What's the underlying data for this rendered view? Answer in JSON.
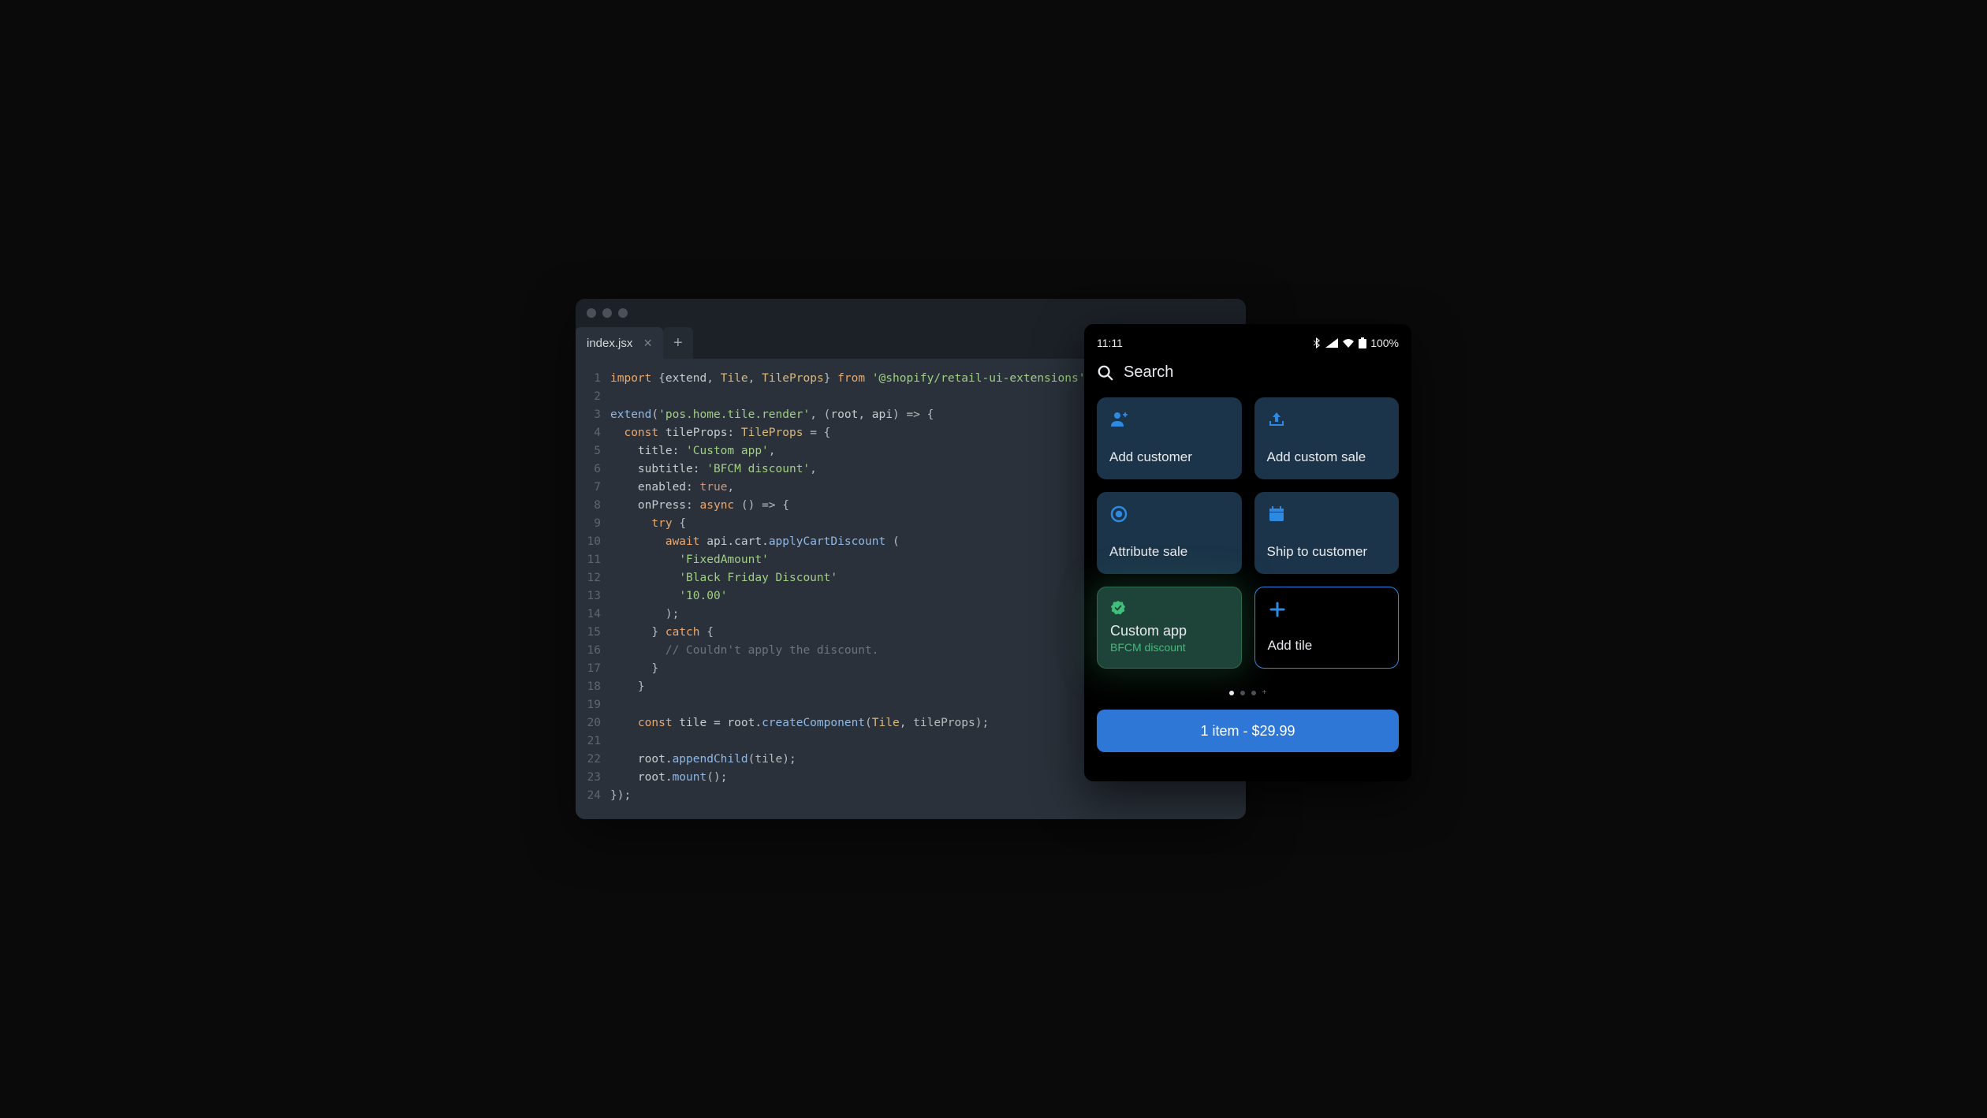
{
  "editor": {
    "tab_label": "index.jsx",
    "line_numbers": [
      "1",
      "2",
      "3",
      "4",
      "5",
      "6",
      "7",
      "8",
      "9",
      "10",
      "11",
      "12",
      "13",
      "14",
      "15",
      "16",
      "17",
      "18",
      "19",
      "20",
      "21",
      "22",
      "23",
      "24"
    ],
    "code": [
      [
        [
          "kw",
          "import"
        ],
        [
          "pun",
          " {"
        ],
        [
          "",
          "extend"
        ],
        [
          "pun",
          ", "
        ],
        [
          "cls",
          "Tile"
        ],
        [
          "pun",
          ", "
        ],
        [
          "cls",
          "TileProps"
        ],
        [
          "pun",
          "} "
        ],
        [
          "kw",
          "from"
        ],
        [
          "",
          " "
        ],
        [
          "str",
          "'@shopify/retail-ui-extensions'"
        ],
        [
          "pun",
          ";"
        ]
      ],
      [],
      [
        [
          "fn",
          "extend"
        ],
        [
          "pun",
          "("
        ],
        [
          "str",
          "'pos.home.tile.render'"
        ],
        [
          "pun",
          ", ("
        ],
        [
          "",
          "root"
        ],
        [
          "pun",
          ", "
        ],
        [
          "",
          "api"
        ],
        [
          "pun",
          ") => {"
        ]
      ],
      [
        [
          "",
          "  "
        ],
        [
          "kw",
          "const"
        ],
        [
          "",
          " tileProps: "
        ],
        [
          "cls",
          "TileProps"
        ],
        [
          "pun",
          " = {"
        ]
      ],
      [
        [
          "",
          "    title: "
        ],
        [
          "str",
          "'Custom app'"
        ],
        [
          "pun",
          ","
        ]
      ],
      [
        [
          "",
          "    subtitle: "
        ],
        [
          "str",
          "'BFCM discount'"
        ],
        [
          "pun",
          ","
        ]
      ],
      [
        [
          "",
          "    enabled: "
        ],
        [
          "lit",
          "true"
        ],
        [
          "pun",
          ","
        ]
      ],
      [
        [
          "",
          "    onPress: "
        ],
        [
          "kw",
          "async"
        ],
        [
          "pun",
          " () => {"
        ]
      ],
      [
        [
          "",
          "      "
        ],
        [
          "kw",
          "try"
        ],
        [
          "pun",
          " {"
        ]
      ],
      [
        [
          "",
          "        "
        ],
        [
          "kw",
          "await"
        ],
        [
          "",
          " api.cart."
        ],
        [
          "fn",
          "applyCartDiscount"
        ],
        [
          "pun",
          " ("
        ]
      ],
      [
        [
          "",
          "          "
        ],
        [
          "str",
          "'FixedAmount'"
        ]
      ],
      [
        [
          "",
          "          "
        ],
        [
          "str",
          "'Black Friday Discount'"
        ]
      ],
      [
        [
          "",
          "          "
        ],
        [
          "str",
          "'10.00'"
        ]
      ],
      [
        [
          "",
          "        "
        ],
        [
          "pun",
          ");"
        ]
      ],
      [
        [
          "",
          "      "
        ],
        [
          "pun",
          "} "
        ],
        [
          "kw",
          "catch"
        ],
        [
          "pun",
          " {"
        ]
      ],
      [
        [
          "",
          "        "
        ],
        [
          "com",
          "// Couldn't apply the discount."
        ]
      ],
      [
        [
          "",
          "      "
        ],
        [
          "pun",
          "}"
        ]
      ],
      [
        [
          "",
          "    "
        ],
        [
          "pun",
          "}"
        ]
      ],
      [],
      [
        [
          "",
          "    "
        ],
        [
          "kw",
          "const"
        ],
        [
          "",
          " tile = root."
        ],
        [
          "fn",
          "createComponent"
        ],
        [
          "pun",
          "("
        ],
        [
          "cls",
          "Tile"
        ],
        [
          "pun",
          ", tileProps);"
        ]
      ],
      [],
      [
        [
          "",
          "    root."
        ],
        [
          "fn",
          "appendChild"
        ],
        [
          "pun",
          "(tile);"
        ]
      ],
      [
        [
          "",
          "    root."
        ],
        [
          "fn",
          "mount"
        ],
        [
          "pun",
          "();"
        ]
      ],
      [
        [
          "pun",
          "});"
        ]
      ]
    ]
  },
  "phone": {
    "status_time": "11:11",
    "battery": "100%",
    "search_label": "Search",
    "tiles": [
      {
        "title": "Add customer",
        "icon": "person"
      },
      {
        "title": "Add custom sale",
        "icon": "upload"
      },
      {
        "title": "Attribute sale",
        "icon": "target"
      },
      {
        "title": "Ship to customer",
        "icon": "calendar"
      }
    ],
    "custom_tile": {
      "title": "Custom app",
      "subtitle": "BFCM discount"
    },
    "add_tile": {
      "title": "Add tile"
    },
    "checkout_label": "1 item - $29.99"
  }
}
